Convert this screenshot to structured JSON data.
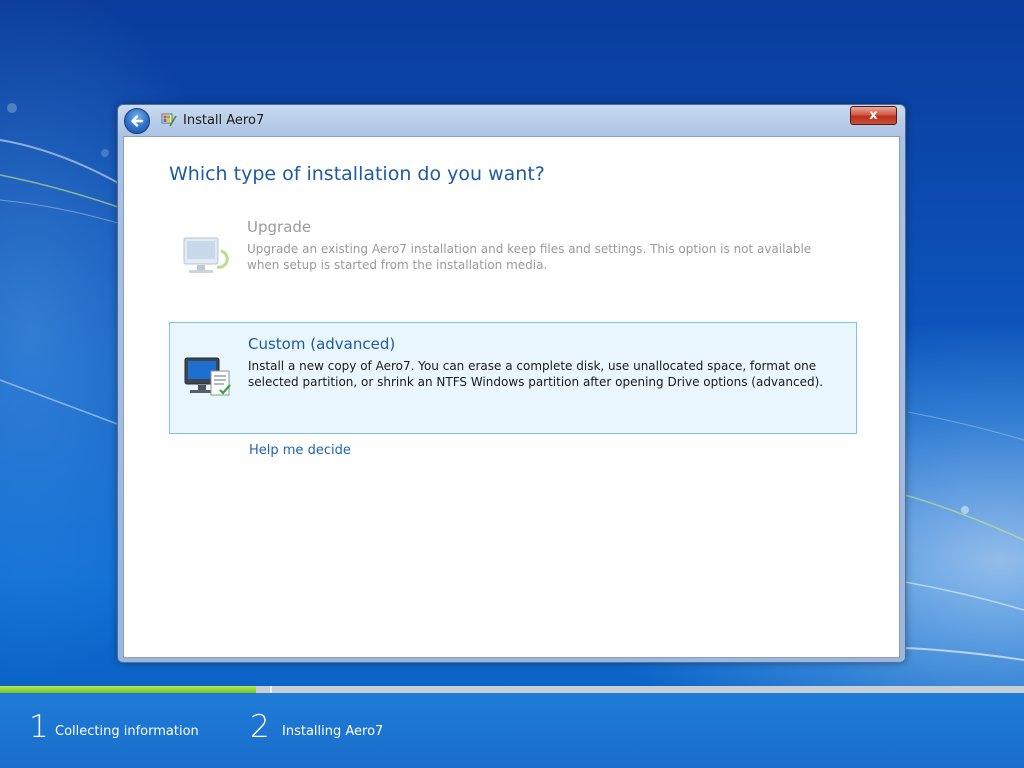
{
  "window": {
    "title": "Install Aero7",
    "close_label": "x"
  },
  "main": {
    "heading": "Which type of installation do you want?",
    "options": [
      {
        "title": "Upgrade",
        "description": "Upgrade an existing Aero7 installation and keep files and settings. This option is not available when setup is started from the installation media.",
        "enabled": false,
        "icon": "computer-upgrade-icon"
      },
      {
        "title": "Custom (advanced)",
        "description": "Install a new copy of Aero7. You can erase a complete disk, use unallocated space, format one selected partition, or shrink an NTFS Windows partition after opening Drive options (advanced).",
        "enabled": true,
        "selected": true,
        "icon": "computer-custom-icon"
      }
    ],
    "help_link": "Help me decide"
  },
  "progress": {
    "fraction": 0.25,
    "steps": [
      {
        "number": "1",
        "label": "Collecting information"
      },
      {
        "number": "2",
        "label": "Installing Aero7"
      }
    ]
  },
  "colors": {
    "heading": "#1e5aa8",
    "link": "#1e62b8",
    "selected_bg": "#eaf6fd",
    "progress_fill": "#7cc21e"
  }
}
